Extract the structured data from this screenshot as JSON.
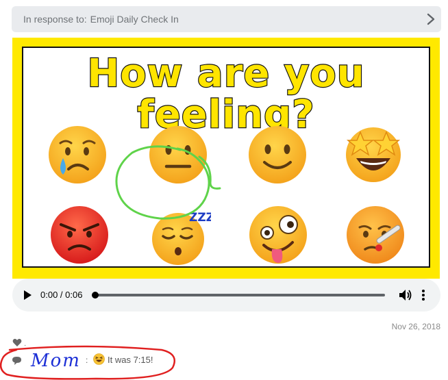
{
  "response": {
    "prefix": "In response to:",
    "target": "Emoji Daily Check In"
  },
  "poster": {
    "title": "How are you feeling?",
    "emojis": [
      "crying-face-icon",
      "neutral-face-icon",
      "slightly-smiling-face-icon",
      "star-struck-face-icon",
      "angry-face-icon",
      "sleeping-face-icon",
      "zany-face-icon",
      "face-with-thermometer-icon"
    ],
    "selected_emoji": "sleeping-face-icon",
    "zzz": "ZZZ"
  },
  "audio": {
    "time": "0:00 / 0:06",
    "progress": 0
  },
  "post": {
    "date": "Nov 26, 2018",
    "like_dot": "·"
  },
  "comment": {
    "author": "Mom",
    "separator": ":",
    "emoji": "grinning-squinting-face-icon",
    "text": "It was 7:15!"
  },
  "colors": {
    "poster_yellow": "#ffe900",
    "author_blue": "#1c2fd6",
    "scribble_green": "#5fd34a",
    "scribble_red": "#e02020"
  }
}
